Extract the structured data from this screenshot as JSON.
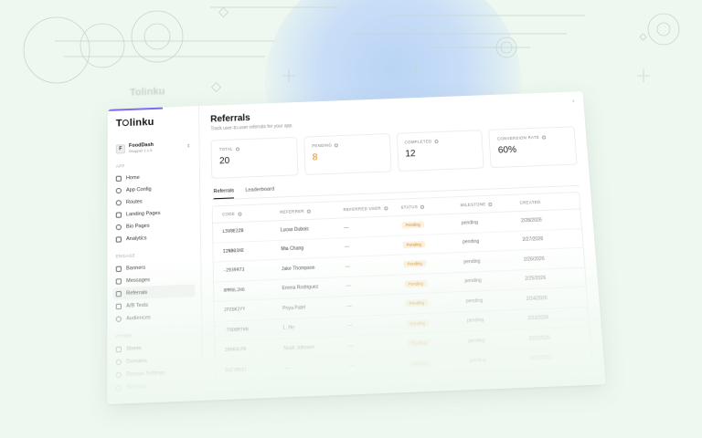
{
  "brand": {
    "ghost_logo": "Tolinku",
    "logo_prefix": "T",
    "logo_suffix": "linku"
  },
  "workspace": {
    "avatar": "F",
    "name": "FoodDash",
    "sub": "Shopper 1.1.0"
  },
  "sidebar": {
    "app_label": "APP",
    "app_items": [
      {
        "label": "Home",
        "icon": "home-icon"
      },
      {
        "label": "App Config",
        "icon": "gear-icon"
      },
      {
        "label": "Routes",
        "icon": "link-icon"
      },
      {
        "label": "Landing Pages",
        "icon": "rocket-icon"
      },
      {
        "label": "Bio Pages",
        "icon": "user-icon"
      },
      {
        "label": "Analytics",
        "icon": "chart-icon"
      }
    ],
    "engage_label": "ENGAGE",
    "engage_items": [
      {
        "label": "Banners",
        "icon": "banner-icon"
      },
      {
        "label": "Messages",
        "icon": "message-icon"
      },
      {
        "label": "Referrals",
        "icon": "gift-icon"
      },
      {
        "label": "A/B Tests",
        "icon": "flask-icon"
      },
      {
        "label": "Audiences",
        "icon": "users-icon"
      }
    ],
    "other_label": "OTHER",
    "other_items": [
      {
        "label": "Stores",
        "icon": "store-icon"
      },
      {
        "label": "Domains",
        "icon": "globe-icon"
      },
      {
        "label": "Domain Settings",
        "icon": "settings-icon"
      },
      {
        "label": "Settings",
        "icon": "cog-icon"
      }
    ]
  },
  "main": {
    "title": "Referrals",
    "subtitle": "Track user-to-user referrals for your app.",
    "stats": [
      {
        "label": "TOTAL",
        "value": "20"
      },
      {
        "label": "PENDING",
        "value": "8"
      },
      {
        "label": "COMPLETED",
        "value": "12"
      },
      {
        "label": "CONVERSION RATE",
        "value": "60%"
      }
    ],
    "tabs": [
      "Referrals",
      "Leaderboard"
    ],
    "table": {
      "columns": [
        "CODE",
        "REFERRER",
        "REFERRED USER",
        "STATUS",
        "MILESTONE",
        "CREATED"
      ],
      "rows": [
        [
          "L5V8E2ZB",
          "Lucas Dubois",
          "—",
          "Pending",
          "pending",
          "2/28/2026"
        ],
        [
          "I2NB03XE",
          "Mia Chang",
          "—",
          "Pending",
          "pending",
          "2/27/2026"
        ],
        [
          "-2939973",
          "Jake Thompson",
          "—",
          "Pending",
          "pending",
          "2/26/2026"
        ],
        [
          "8MM8L2H6",
          "Emma Rodriguez",
          "—",
          "Pending",
          "pending",
          "2/25/2026"
        ],
        [
          "JPZ6K2YY",
          "Priya Patel",
          "—",
          "Pending",
          "pending",
          "2/24/2026"
        ],
        [
          "-T8DBM7HN",
          "L. Ho",
          "—",
          "Pending",
          "pending",
          "2/23/2026"
        ],
        [
          "2B6K4LP8",
          "Noah Johnson",
          "—",
          "Pending",
          "pending",
          "2/22/2026"
        ],
        [
          "9QZ7MX31",
          "—",
          "—",
          "Pending",
          "pending",
          "2/21/2026"
        ]
      ]
    }
  }
}
